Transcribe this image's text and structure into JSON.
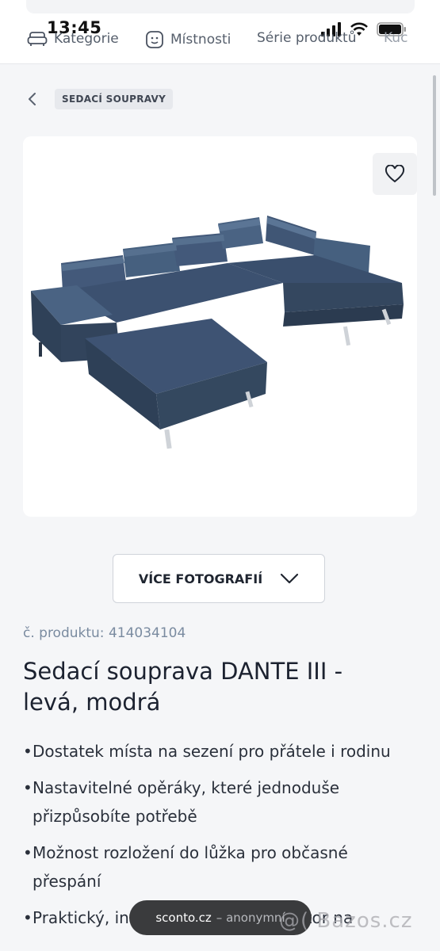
{
  "status_bar": {
    "time": "13:45"
  },
  "nav": {
    "items": [
      {
        "label": "Kategorie",
        "icon": "sofa-icon"
      },
      {
        "label": "Místnosti",
        "icon": "smiley-icon"
      },
      {
        "label": "Série produktů"
      },
      {
        "label": "Kuc"
      }
    ]
  },
  "breadcrumb": {
    "back_icon": "chevron-left-icon",
    "label": "SEDACÍ SOUPRAVY"
  },
  "product": {
    "more_photos_label": "VÍCE FOTOGRAFIÍ",
    "product_number": "č. produktu: 414034104",
    "title": "Sedací souprava DANTE III - levá, modrá",
    "features": [
      "Dostatek místa na sezení pro přátele i rodinu",
      "Nastavitelné opěráky, které jednoduše přizpůsobíte potřebě",
      "Možnost rozložení do lůžka pro občasné přespání",
      "Praktický, integrovaný úložný prostor na"
    ]
  },
  "toast": {
    "domain": "sconto.cz",
    "mode": "– anonymní"
  },
  "watermark": "@( Bazos.cz",
  "colors": {
    "sofa": "#3a4f68",
    "background": "#f5f6f8",
    "accent_text": "#7a8ba0"
  }
}
